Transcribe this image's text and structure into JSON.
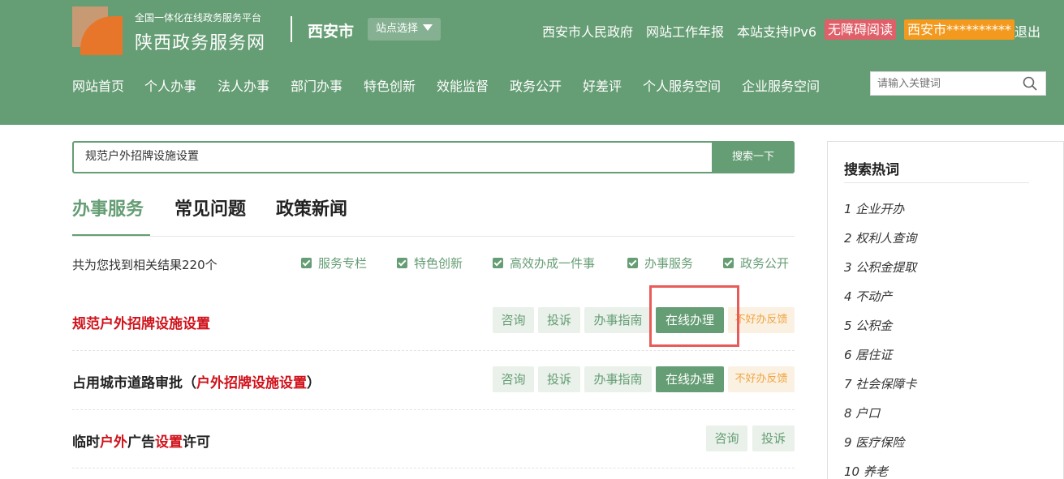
{
  "header": {
    "subtitle": "全国一体化在线政务服务平台",
    "title": "陕西政务服务网",
    "city": "西安市",
    "site_select": "站点选择",
    "links": [
      "西安市人民政府",
      "网站工作年报",
      "本站支持IPv6"
    ],
    "accessible_label": "无障碍阅读",
    "user_label": "西安市**********",
    "logout": "退出",
    "nav": [
      "网站首页",
      "个人办事",
      "法人办事",
      "部门办事",
      "特色创新",
      "效能监督",
      "政务公开",
      "好差评",
      "个人服务空间",
      "企业服务空间"
    ],
    "search_placeholder": "请输入关键词"
  },
  "search": {
    "value": "规范户外招牌设施设置",
    "button": "搜索一下"
  },
  "tabs": [
    "办事服务",
    "常见问题",
    "政策新闻"
  ],
  "results": {
    "count_text": "共为您找到相关结果220个",
    "filters": [
      "服务专栏",
      "特色创新",
      "高效办成一件事",
      "办事服务",
      "政务公开"
    ],
    "items": [
      {
        "title": "规范户外招牌设施设置",
        "buttons": [
          "咨询",
          "投诉",
          "办事指南",
          "在线办理",
          "不好办反馈"
        ]
      },
      {
        "title_prefix": "占用城市道路审批（",
        "title_highlight": "户外招牌设施设置",
        "title_suffix": "）",
        "buttons": [
          "咨询",
          "投诉",
          "办事指南",
          "在线办理",
          "不好办反馈"
        ]
      },
      {
        "title_parts": [
          "临时",
          "户外",
          "广告",
          "设置",
          "许可"
        ],
        "buttons": [
          "咨询",
          "投诉"
        ]
      }
    ]
  },
  "sidebar": {
    "title": "搜索热词",
    "hot_words": [
      "1 企业开办",
      "2 权利人查询",
      "3 公积金提取",
      "4 不动产",
      "5 公积金",
      "6 居住证",
      "7 社会保障卡",
      "8 户口",
      "9 医疗保险",
      "10 养老"
    ]
  },
  "colors": {
    "brand_green": "#659d74",
    "highlight_red": "#d0121b",
    "annotation_box": "#e85b58"
  }
}
